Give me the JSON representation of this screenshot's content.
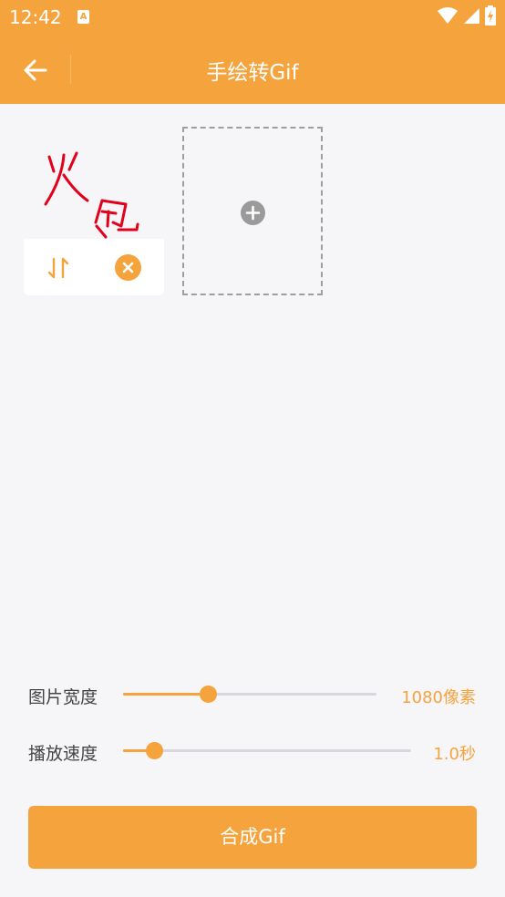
{
  "status_bar": {
    "time": "12:42",
    "notification_badge": "A",
    "icons": [
      "wifi-icon",
      "signal-icon",
      "battery-charging-icon"
    ]
  },
  "app_bar": {
    "title": "手绘转Gif",
    "back_icon": "arrow-left-icon"
  },
  "frames": {
    "items": [
      {
        "drawing_text": "火包",
        "controls": [
          "swap-icon",
          "remove-icon"
        ]
      }
    ],
    "add_icon": "plus-circle-icon"
  },
  "settings": {
    "width": {
      "label": "图片宽度",
      "value": "1080像素",
      "fraction": 0.34
    },
    "speed": {
      "label": "播放速度",
      "value": "1.0秒",
      "fraction": 0.11
    }
  },
  "actions": {
    "compose_label": "合成Gif"
  },
  "colors": {
    "accent": "#f5a33d",
    "background": "#f6f5f8",
    "drawing_ink": "#e3001b"
  }
}
